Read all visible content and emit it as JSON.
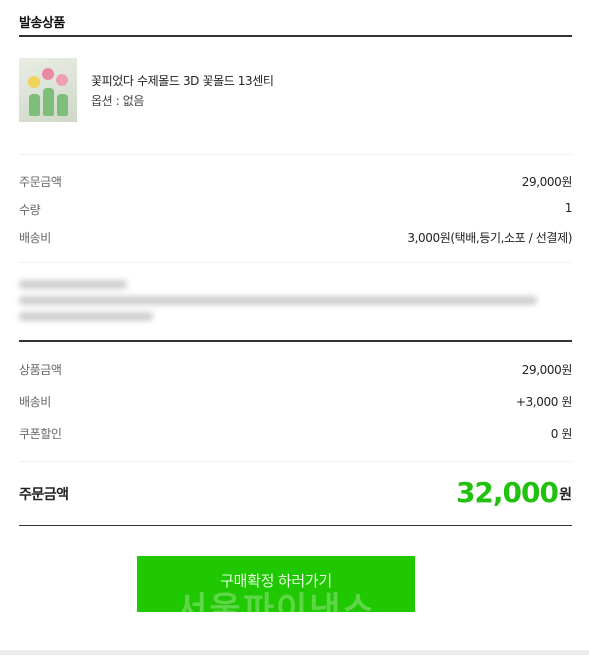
{
  "section": {
    "title": "발송상품"
  },
  "product": {
    "name": "꽃피었다 수제몰드 3D 꽃몰드 13센티",
    "option": "옵션 : 없음"
  },
  "order_rows": [
    {
      "label": "주문금액",
      "value": "29,000원"
    },
    {
      "label": "수량",
      "value": "1"
    },
    {
      "label": "배송비",
      "value": "3,000원(택배,등기,소포 / 선결제)"
    }
  ],
  "summary_rows": [
    {
      "label": "상품금액",
      "value": "29,000원"
    },
    {
      "label": "배송비",
      "value": "+3,000 원"
    },
    {
      "label": "쿠폰할인",
      "value": "0 원"
    }
  ],
  "total": {
    "label": "주문금액",
    "amount": "32,000",
    "unit": "원"
  },
  "button": {
    "label": "구매확정 하러가기",
    "watermark": "서울파이낸스"
  },
  "colors": {
    "accent": "#1fc800",
    "total_amount": "#22c00f"
  }
}
